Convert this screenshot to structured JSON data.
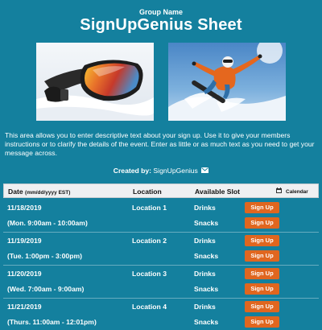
{
  "header": {
    "group_name": "Group Name",
    "title": "SignUpGenius Sheet"
  },
  "description": "This area allows you to enter descriptive text about your sign up. Use it to give your members instructions or to clarify the details of the event. Enter as little or as much text as you need to get your message across.",
  "created_by": {
    "label": "Created by:",
    "name": "SignUpGenius"
  },
  "table": {
    "header": {
      "date": "Date",
      "date_format": "(mm/dd/yyyy EST)",
      "location": "Location",
      "available_slot": "Available Slot",
      "calendar": "Calendar"
    },
    "groups": [
      {
        "date": "11/18/2019",
        "time": "(Mon. 9:00am - 10:00am)",
        "location": "Location 1",
        "slots": [
          {
            "name": "Drinks",
            "button": "Sign Up"
          },
          {
            "name": "Snacks",
            "button": "Sign Up"
          }
        ]
      },
      {
        "date": "11/19/2019",
        "time": "(Tue. 1:00pm - 3:00pm)",
        "location": "Location 2",
        "slots": [
          {
            "name": "Drinks",
            "button": "Sign Up"
          },
          {
            "name": "Snacks",
            "button": "Sign Up"
          }
        ]
      },
      {
        "date": "11/20/2019",
        "time": "(Wed. 7:00am - 9:00am)",
        "location": "Location 3",
        "slots": [
          {
            "name": "Drinks",
            "button": "Sign Up"
          },
          {
            "name": "Snacks",
            "button": "Sign Up"
          }
        ]
      },
      {
        "date": "11/21/2019",
        "time": "(Thurs. 11:00am - 12:01pm)",
        "location": "Location 4",
        "slots": [
          {
            "name": "Drinks",
            "button": "Sign Up"
          },
          {
            "name": "Snacks",
            "button": "Sign Up"
          }
        ]
      }
    ]
  },
  "colors": {
    "background": "#14809e",
    "button": "#e0661f",
    "header_row": "#eef0f2"
  },
  "icons": {
    "mail": "envelope-icon",
    "calendar": "calendar-icon"
  }
}
